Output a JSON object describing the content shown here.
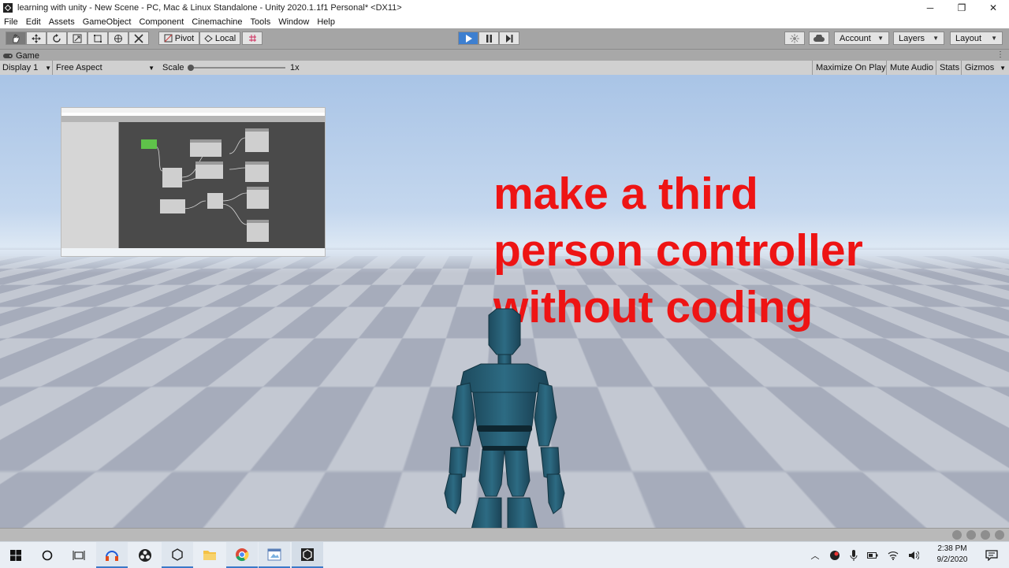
{
  "window": {
    "title": "learning with unity - New Scene - PC, Mac & Linux Standalone - Unity 2020.1.1f1 Personal* <DX11>",
    "minimize": "─",
    "maximize": "❐",
    "close": "✕"
  },
  "menu": [
    "File",
    "Edit",
    "Assets",
    "GameObject",
    "Component",
    "Cinemachine",
    "Tools",
    "Window",
    "Help"
  ],
  "toolbar": {
    "pivot_label": "Pivot",
    "local_label": "Local",
    "account_label": "Account",
    "layers_label": "Layers",
    "layout_label": "Layout"
  },
  "game_tab": {
    "label": "Game",
    "display_label": "Display 1",
    "aspect_label": "Free Aspect",
    "scale_label": "Scale",
    "scale_value": "1x",
    "maximize_on_play": "Maximize On Play",
    "mute_audio": "Mute Audio",
    "stats": "Stats",
    "gizmos": "Gizmos"
  },
  "overlay": {
    "headline_lines": [
      "make a third",
      "person controller",
      "without coding"
    ],
    "headline_color": "#ee1414"
  },
  "taskbar": {
    "time": "2:38 PM",
    "date": "9/2/2020"
  }
}
